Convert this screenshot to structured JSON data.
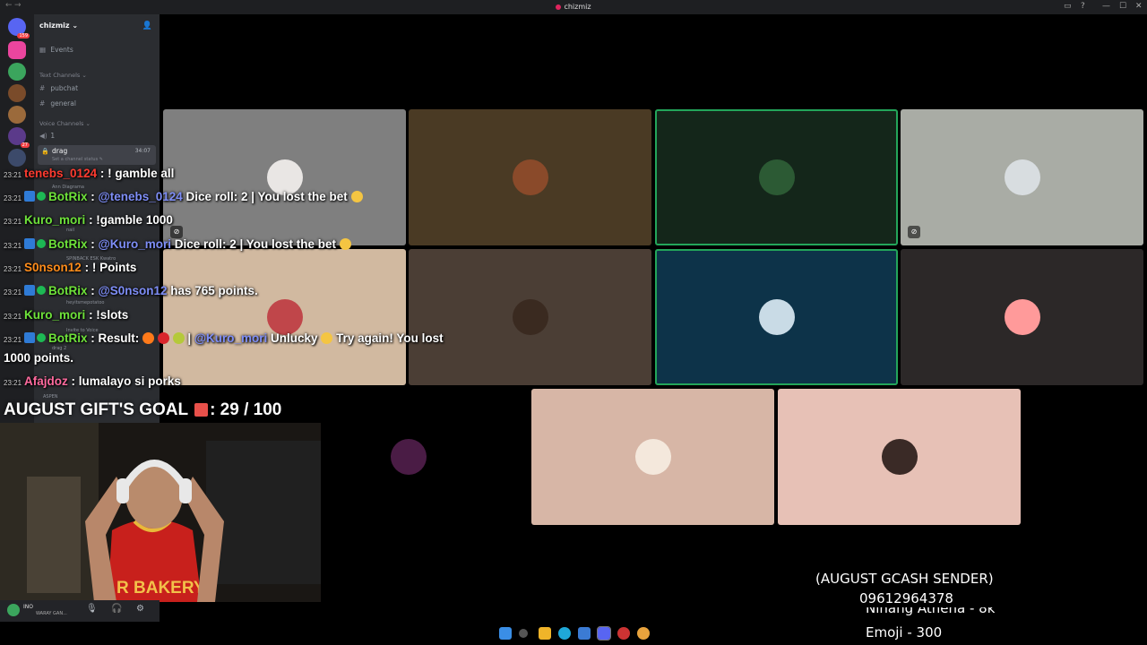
{
  "window": {
    "title": "chizmiz",
    "nav_back": "←",
    "nav_forward": "→",
    "controls": [
      "▭",
      "?",
      "—",
      "☐",
      "✕"
    ]
  },
  "servers": [
    {
      "name": "discord-home",
      "badge": "159",
      "color": "#5865f2"
    },
    {
      "name": "server-heart",
      "badge": "",
      "color": "#eb459e"
    },
    {
      "name": "server-2",
      "badge": "",
      "color": "#3ba55d"
    },
    {
      "name": "server-3",
      "badge": "",
      "color": "#7a4b2a"
    },
    {
      "name": "server-4",
      "badge": "",
      "color": "#9b6a3b"
    },
    {
      "name": "server-5",
      "badge": "27",
      "color": "#5b3a8a"
    },
    {
      "name": "server-6",
      "badge": "",
      "color": "#3c4a6a"
    }
  ],
  "sidebar": {
    "server_name": "chizmiz ⌄",
    "events_label": "Events",
    "text_category": "Text Channels ⌄",
    "text_channels": [
      "pubchat",
      "general"
    ],
    "voice_category": "Voice Channels ⌄",
    "voice_channels": [
      {
        "name": "1"
      },
      {
        "name": "drag",
        "time": "34:07",
        "status": "Set a channel status ✎"
      }
    ],
    "faint_items": [
      "Ann Diagrama",
      "nail",
      "SPINBACK ESK Kwatro",
      "heyitsmepotatoo",
      "Invite to Voice",
      "drag 2",
      "ASPEN"
    ]
  },
  "user_panel": {
    "name": "INO",
    "status": "WARAY GAN...",
    "mic_icon": "🎙",
    "headset_icon": "🎧",
    "settings_icon": "⚙"
  },
  "video_tiles": [
    {
      "name": "tile-1",
      "bg": "#7f7f7f",
      "muted": true,
      "speaking": false,
      "avatar": "#e9e6e4"
    },
    {
      "name": "tile-2",
      "bg": "#4a3a24",
      "muted": false,
      "speaking": false,
      "avatar": "#8a4a2a"
    },
    {
      "name": "tile-3",
      "bg": "#14261a",
      "muted": false,
      "speaking": true,
      "avatar": "#2c5a34"
    },
    {
      "name": "tile-4",
      "bg": "#a9aca5",
      "muted": true,
      "speaking": false,
      "avatar": "#d8dde0"
    },
    {
      "name": "tile-5",
      "bg": "#d1b9a0",
      "muted": false,
      "speaking": false,
      "avatar": "#c0464a"
    },
    {
      "name": "tile-6",
      "bg": "#4b3e35",
      "muted": false,
      "speaking": false,
      "avatar": "#3a2a20"
    },
    {
      "name": "tile-7",
      "bg": "#0d3349",
      "muted": false,
      "speaking": true,
      "avatar": "#c9dbe6"
    },
    {
      "name": "tile-8",
      "bg": "#2c2828",
      "muted": false,
      "speaking": false,
      "avatar": "#ff9a9a"
    },
    {
      "name": "tile-9",
      "bg": "#000000",
      "muted": false,
      "speaking": false,
      "avatar": "#4a1c45"
    },
    {
      "name": "tile-10",
      "bg": "#d7b6a6",
      "muted": false,
      "speaking": false,
      "avatar": "#f4e8dc"
    },
    {
      "name": "tile-11",
      "bg": "#e7c1b6",
      "muted": false,
      "speaking": false,
      "avatar": "#3a2a26"
    }
  ],
  "chat": [
    {
      "time": "23:21",
      "user": "tenebs_0124",
      "user_color": "u-red",
      "bot": false,
      "text": ": ! gamble all"
    },
    {
      "time": "23:21",
      "user": "BotRix",
      "user_color": "u-green",
      "bot": true,
      "mention": "@tenebs_0124",
      "text": " Dice roll: 2 | You lost the bet"
    },
    {
      "time": "23:21",
      "user": "Kuro_mori",
      "user_color": "u-green",
      "bot": false,
      "text": ": !gamble 1000"
    },
    {
      "time": "23:21",
      "user": "BotRix",
      "user_color": "u-green",
      "bot": true,
      "mention": "@Kuro_mori",
      "text": " Dice roll: 2 | You lost the bet"
    },
    {
      "time": "23:21",
      "user": "S0nson12",
      "user_color": "u-orange",
      "bot": false,
      "text": ": ! Points"
    },
    {
      "time": "23:21",
      "user": "BotRix",
      "user_color": "u-green",
      "bot": true,
      "mention": "@S0nson12",
      "text": " has 765 points."
    },
    {
      "time": "23:21",
      "user": "Kuro_mori",
      "user_color": "u-green",
      "bot": false,
      "text": ": !slots"
    },
    {
      "time": "23:21",
      "user": "BotRix",
      "user_color": "u-green",
      "bot": true,
      "prefix": ": Result:",
      "mention": "@Kuro_mori",
      "text": " Unlucky",
      "tail": " Try again! You lost"
    },
    {
      "time": "",
      "user": "",
      "user_color": "",
      "bot": false,
      "text": "1000 points."
    },
    {
      "time": "23:21",
      "user": "Afajdoz",
      "user_color": "u-pink",
      "bot": false,
      "text": ": lumalayo si porks"
    }
  ],
  "gift_goal": {
    "label": "AUGUST GIFT'S GOAL",
    "progress": ": 29 / 100"
  },
  "sender_info": {
    "title": "(AUGUST GCASH SENDER)",
    "number": "09612964378",
    "line1": "Ninang Athena - 8k",
    "line2": "Emoji - 300"
  },
  "taskbar_icons": [
    {
      "name": "windows-start-icon",
      "color": "#3a8ee6"
    },
    {
      "name": "search-icon",
      "color": "#555555"
    },
    {
      "name": "file-explorer-icon",
      "color": "#f0b429"
    },
    {
      "name": "edge-icon",
      "color": "#1fa8d8"
    },
    {
      "name": "store-icon",
      "color": "#3b7bd4"
    },
    {
      "name": "discord-icon",
      "color": "#5865f2"
    },
    {
      "name": "obs-icon",
      "color": "#cc3333"
    },
    {
      "name": "chrome-icon",
      "color": "#e8a33d"
    }
  ]
}
